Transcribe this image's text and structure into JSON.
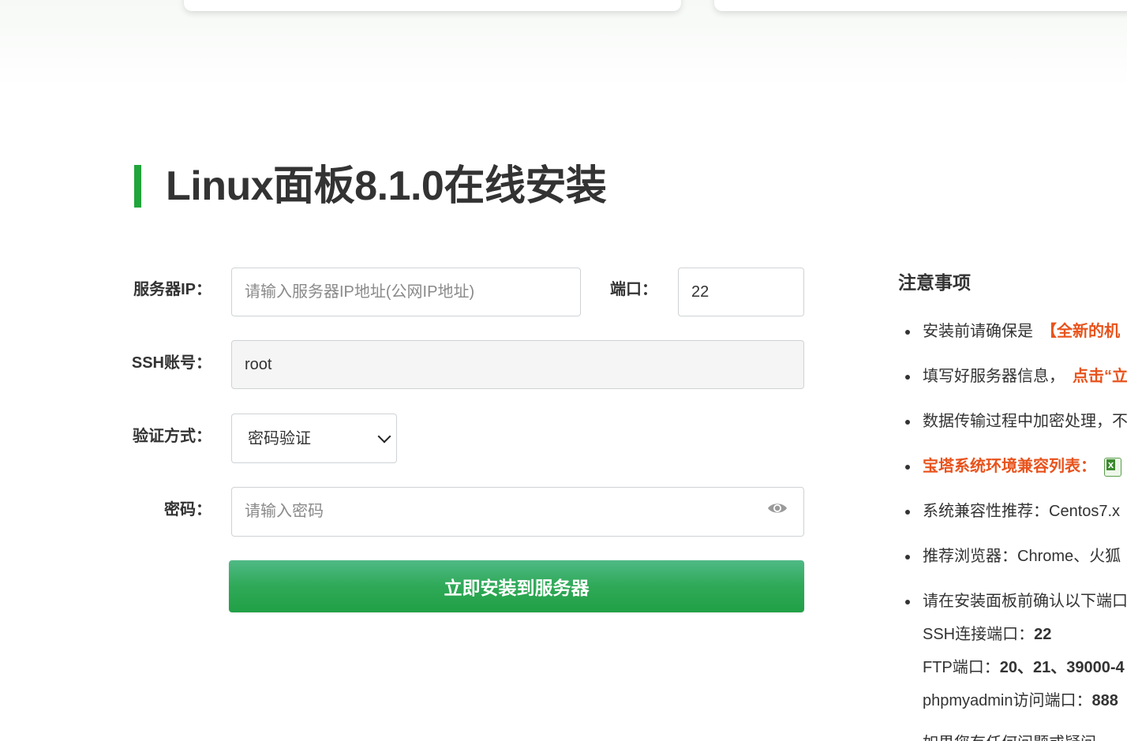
{
  "page": {
    "title": "Linux面板8.1.0在线安装",
    "accent_color": "#20a53a"
  },
  "form": {
    "server_ip": {
      "label": "服务器IP：",
      "placeholder": "请输入服务器IP地址(公网IP地址)",
      "value": ""
    },
    "port": {
      "label": "端口：",
      "value": "22"
    },
    "ssh_account": {
      "label": "SSH账号：",
      "value": "root"
    },
    "auth_method": {
      "label": "验证方式：",
      "selected": "密码验证"
    },
    "password": {
      "label": "密码：",
      "placeholder": "请输入密码",
      "value": ""
    },
    "submit_label": "立即安装到服务器"
  },
  "icons": {
    "password_toggle": "eye-icon",
    "select_arrow": "chevron-down-icon",
    "compat_table": "excel-icon"
  },
  "notes": {
    "title": "注意事项",
    "items": [
      {
        "text": "安装前请确保是",
        "highlight": "【全新的机"
      },
      {
        "text": "填写好服务器信息，",
        "highlight": "点击“立"
      },
      {
        "text": "数据传输过程中加密处理，不"
      },
      {
        "highlight": "宝塔系统环境兼容列表："
      },
      {
        "text": "系统兼容性推荐：Centos7.x"
      },
      {
        "text": "推荐浏览器：Chrome、火狐"
      },
      {
        "text": "请在安装面板前确认以下端口"
      }
    ],
    "ports": [
      {
        "label": "SSH连接端口：",
        "value": "22"
      },
      {
        "label": "FTP端口：",
        "value": "20、21、39000-4"
      },
      {
        "label": "phpmyadmin访问端口：",
        "value": "888"
      }
    ],
    "last_partial": "如果您有任何问题或疑问，"
  }
}
